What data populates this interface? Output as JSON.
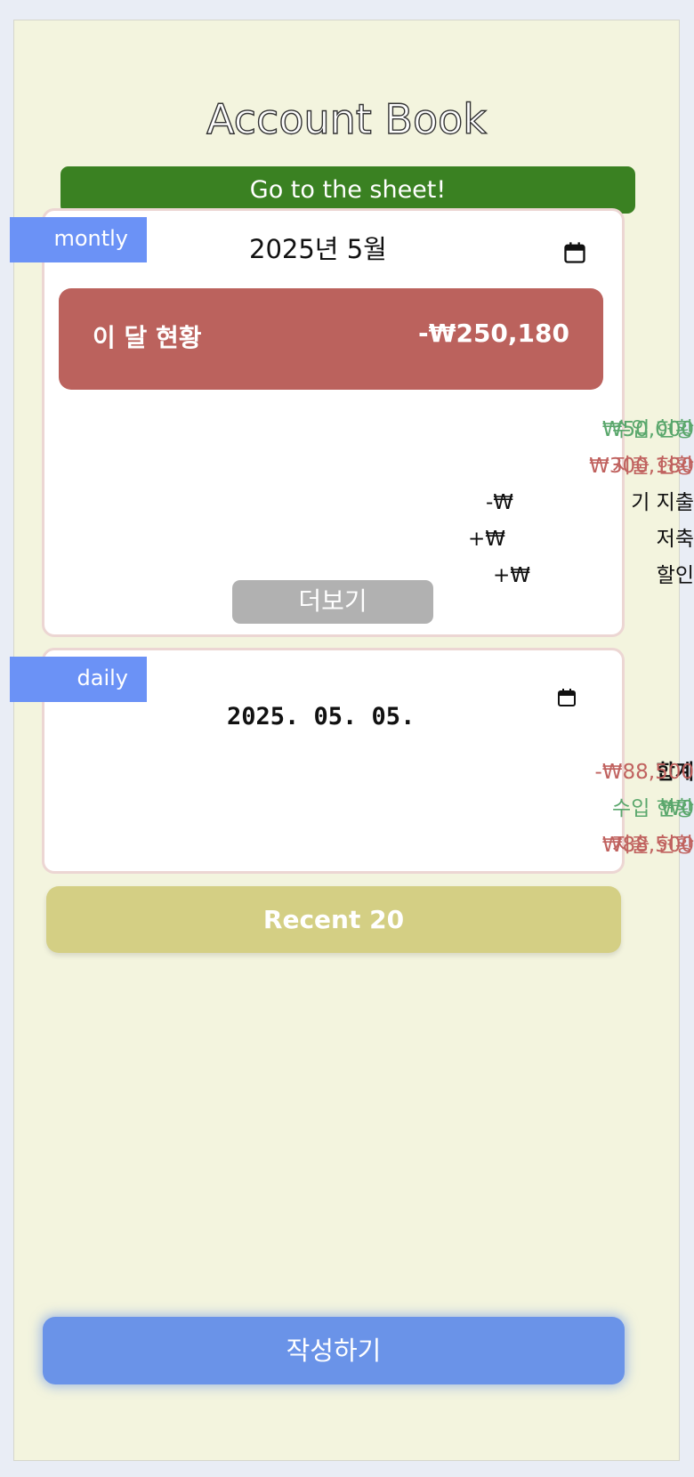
{
  "app": {
    "title": "Account Book"
  },
  "sheet_button": "Go to the sheet!",
  "monthly": {
    "tag": "montly",
    "date_value": "2025년 5월",
    "summary_label": "이 달 현황",
    "summary_value": "-₩250,180",
    "rows": [
      {
        "label": "수입 현황",
        "value": "₩50,000",
        "color": "#5aa76c"
      },
      {
        "label": "지출 현황",
        "value": "₩300,180",
        "color": "#c0625f"
      },
      {
        "label": "기 지출",
        "value": "-₩",
        "color": "#111111"
      },
      {
        "label": "저축",
        "value": "+₩",
        "color": "#111111"
      },
      {
        "label": "할인",
        "value": "+₩",
        "color": "#111111"
      }
    ],
    "more_button": "더보기"
  },
  "daily": {
    "tag": "daily",
    "date_value": "2025. 05. 05.",
    "rows": [
      {
        "label": "합계",
        "value": "-₩88,500"
      },
      {
        "label": "수입 현황",
        "value": "₩0"
      },
      {
        "label": "지출 현황",
        "value": "₩88,500"
      }
    ]
  },
  "recent_button": "Recent 20",
  "write_button": "작성하기",
  "colors": {
    "background": "#f3f4de",
    "sheet_button": "#3a8122",
    "tag": "#6b92f6",
    "summary": "#bb625d",
    "income": "#5aa76c",
    "expense": "#c0625f",
    "recent_button": "#d4cf84",
    "write_button": "#6a93e8"
  },
  "icons": {
    "calendar": "calendar-icon"
  }
}
